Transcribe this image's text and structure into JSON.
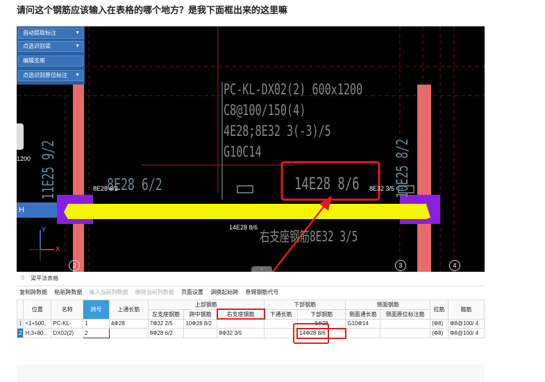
{
  "question": "请问这个钢筋应该输入在表格的哪个地方？是我下面框出来的这里嘛",
  "side_panel": {
    "buttons": [
      {
        "label": "自动提取标注",
        "has_arrow": true
      },
      {
        "label": "点选识别梁",
        "has_arrow": true
      },
      {
        "label": "编辑支座",
        "has_arrow": false
      },
      {
        "label": "点选识别原位标注",
        "has_arrow": true
      }
    ]
  },
  "cad": {
    "beam_annotation": [
      "PC-KL-DX02(2) 600x1200",
      "C8@100/150(4)",
      "4E28;8E32 3(-3)/5",
      "G10C14"
    ],
    "boxed_text": "14E28 8/6",
    "right_small_text": "8E32 3/5",
    "left_small_text": "8E28 6/2",
    "left_big_text": "8E28 6/2",
    "below_beam_text": "14E28 8/6",
    "right_bottom_text": "右支座钢筋8E32 3/5",
    "left_vertical_text": "11E25 9/2",
    "right_vertical_text": "10E25 8/2",
    "left_edge_number": "1200",
    "h_label": "H",
    "axis_markers": [
      "2",
      "3",
      "4"
    ],
    "axis_y": "Y",
    "axis_x": "X",
    "colors": {
      "column": "#e86a6a",
      "beam": "#f5f500",
      "support": "#8a1fe0",
      "highlight_box": "#e81a1a",
      "arrow": "#e81a1a"
    }
  },
  "panel": {
    "title": "梁平法表格",
    "toolbar": [
      {
        "label": "复制跨数据",
        "enabled": true
      },
      {
        "label": "粘贴跨数据",
        "enabled": true
      },
      {
        "label": "输入当前列数据",
        "enabled": false
      },
      {
        "label": "删除当前列数据",
        "enabled": false
      },
      {
        "label": "页面设置",
        "enabled": true
      },
      {
        "label": "调换起始跨",
        "enabled": true
      },
      {
        "label": "悬臂钢筋代号",
        "enabled": true
      }
    ],
    "group_headers": {
      "top_rebar": "上部钢筋",
      "bottom_rebar": "下部钢筋",
      "side_rebar": "侧面钢筋"
    },
    "columns": {
      "position": "位置",
      "name": "名称",
      "span": "跨号",
      "top_through": "上通长筋",
      "left_support": "左支座钢筋",
      "mid_span": "跨中钢筋",
      "right_support": "右支座钢筋",
      "bottom_through": "下通长筋",
      "bottom_rebar": "下部钢筋",
      "side_through": "侧面通长筋",
      "side_in_situ": "侧面原位标注筋",
      "tie": "拉筋",
      "stirrup": "箍筋"
    },
    "rows": [
      {
        "num": "1",
        "position": "<1+500,",
        "name": "PC-KL-",
        "span": "1",
        "top_through": "4Φ28",
        "left_support": "7Φ32 2/5",
        "mid_span": "10Φ28 8/2",
        "right_support": "",
        "bottom_through": "",
        "bottom_rebar": "6Φ28",
        "side_through": "G10Φ14",
        "side_in_situ": "",
        "tie": "(Φ8)",
        "stirrup": "Φ8@100/ 4"
      },
      {
        "num": "2",
        "position": "H;3+80...",
        "name": "DX02(2)",
        "span": "2",
        "top_through": "",
        "left_support": "8Φ28 6/2",
        "mid_span": "",
        "right_support": "8Φ32 3/5",
        "bottom_through": "",
        "bottom_rebar": "14Φ28 8/6",
        "side_through": "",
        "side_in_situ": "",
        "tie": "(Φ8)",
        "stirrup": "Φ8@100/ 4"
      }
    ]
  }
}
